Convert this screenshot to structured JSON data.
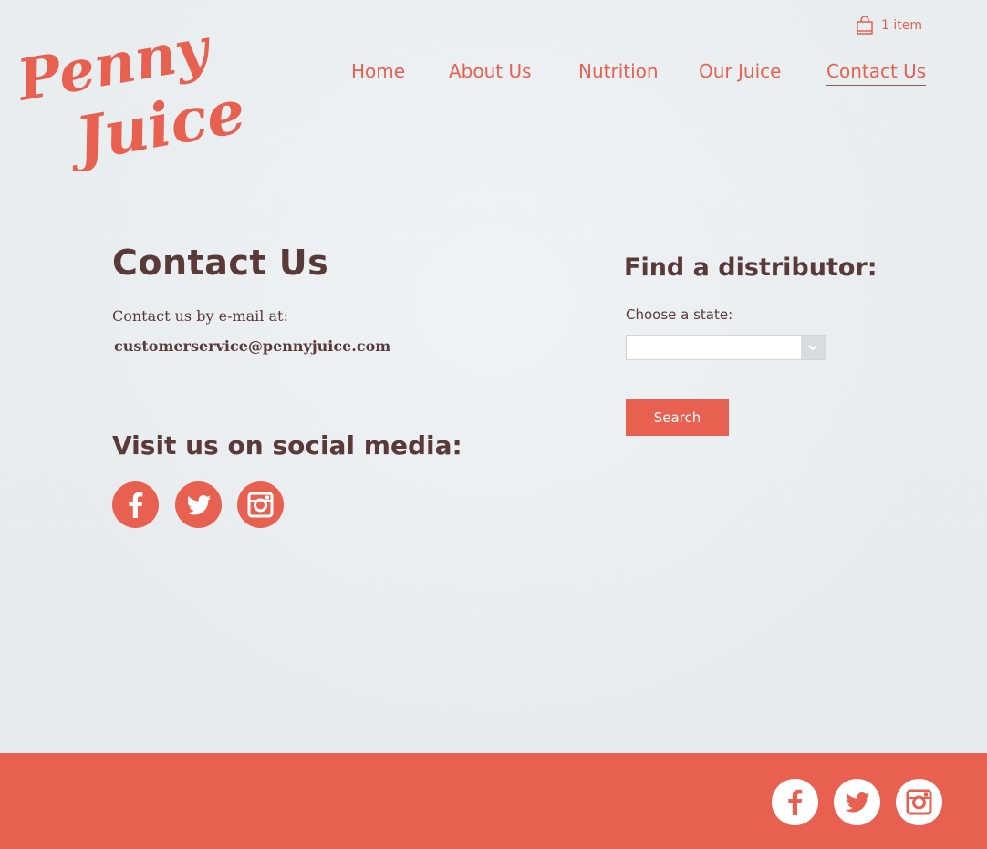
{
  "brand": {
    "logo_text_line1": "Penny",
    "logo_text_line2": "Juice",
    "accent_color": "#e8604f",
    "heading_color": "#5a3a38"
  },
  "cart": {
    "icon": "shopping-bag-icon",
    "label": "1 item"
  },
  "nav": {
    "items": [
      {
        "label": "Home",
        "active": false
      },
      {
        "label": "About Us",
        "active": false
      },
      {
        "label": "Nutrition",
        "active": false
      },
      {
        "label": "Our Juice",
        "active": false
      },
      {
        "label": "Contact Us",
        "active": true
      }
    ]
  },
  "contact": {
    "title": "Contact Us",
    "intro": "Contact us by e-mail at:",
    "email": "customerservice@pennyjuice.com"
  },
  "social": {
    "title": "Visit us on social media:",
    "icons": [
      "facebook-icon",
      "twitter-icon",
      "instagram-icon"
    ]
  },
  "distributor": {
    "title": "Find a distributor:",
    "state_label": "Choose a state:",
    "state_value": "",
    "search_label": "Search"
  },
  "footer": {
    "background_color": "#e8604f",
    "icons": [
      "facebook-icon",
      "twitter-icon",
      "instagram-icon"
    ]
  }
}
